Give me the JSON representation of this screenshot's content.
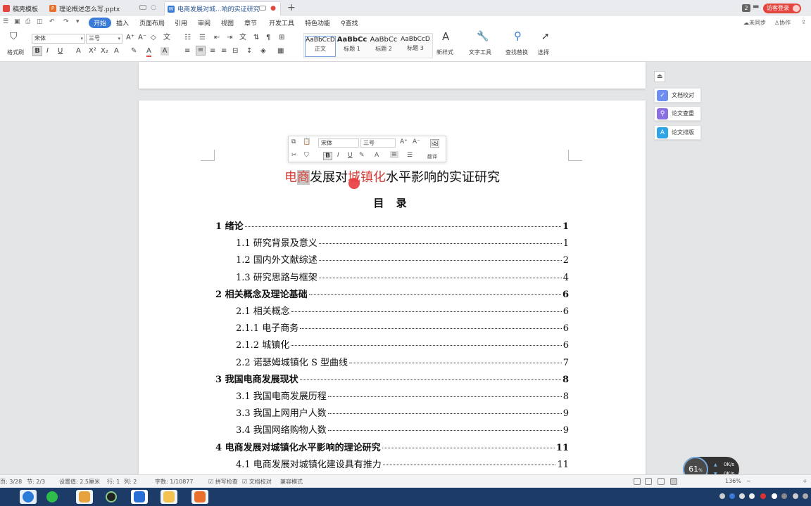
{
  "tabs": [
    {
      "label": "稿壳模板",
      "color": "#e2463f"
    },
    {
      "label": "理论概述怎么写.pptx",
      "color": "#e8702a"
    },
    {
      "label": "电商发展对城...响的实证研究",
      "color": "#3a7bd5"
    }
  ],
  "tab_count": "2",
  "guest_label": "访客登录",
  "menu": {
    "start": "开始",
    "items": [
      "插入",
      "页面布局",
      "引用",
      "审阅",
      "视图",
      "章节",
      "开发工具",
      "特色功能"
    ],
    "search": "查找",
    "right": [
      "未同步",
      "协作",
      "分享"
    ]
  },
  "ribbon": {
    "format_painter": "格式刷",
    "font_name": "宋体",
    "font_size": "三号",
    "styles": [
      {
        "preview": "AaBbCcD",
        "label": "正文"
      },
      {
        "preview": "AaBbCc",
        "label": "标题 1"
      },
      {
        "preview": "AaBbCc",
        "label": "标题 2"
      },
      {
        "preview": "AaBbCcD",
        "label": "标题 3"
      }
    ],
    "new_style": "新样式",
    "text_tools": "文字工具",
    "find_replace": "查找替换",
    "select": "选择"
  },
  "document": {
    "title_parts": [
      "电",
      "商",
      "发展对",
      "城镇化",
      "水平影响的实证研究"
    ],
    "toc_heading": "目 录",
    "toc": [
      {
        "level": 1,
        "text": "1  绪论",
        "page": "1"
      },
      {
        "level": 2,
        "text": "1.1 研究背景及意义",
        "page": "1"
      },
      {
        "level": 2,
        "text": "1.2 国内外文献综述",
        "page": "2"
      },
      {
        "level": 2,
        "text": "1.3  研究思路与框架",
        "page": "4"
      },
      {
        "level": 1,
        "text": "2  相关概念及理论基础",
        "page": "6"
      },
      {
        "level": 2,
        "text": "2.1 相关概念",
        "page": "6"
      },
      {
        "level": 2,
        "text": "2.1.1 电子商务",
        "page": "6"
      },
      {
        "level": 2,
        "text": "2.1.2 城镇化",
        "page": "6"
      },
      {
        "level": 2,
        "text": "2.2 诺瑟姆城镇化 S 型曲线",
        "page": "7"
      },
      {
        "level": 1,
        "text": "3  我国电商发展现状",
        "page": "8"
      },
      {
        "level": 2,
        "text": "3.1 我国电商发展历程",
        "page": "8"
      },
      {
        "level": 2,
        "text": "3.3 我国上网用户人数",
        "page": "9"
      },
      {
        "level": 2,
        "text": "3.4 我国网络购物人数",
        "page": "9"
      },
      {
        "level": 1,
        "text": "4  电商发展对城镇化水平影响的理论研究",
        "page": "11"
      },
      {
        "level": 2,
        "text": "4.1  电商发展对城镇化建设具有推力",
        "page": "11"
      }
    ]
  },
  "minibar": {
    "font_name": "宋体",
    "font_size": "三号",
    "translate": "翻译"
  },
  "right_panel": [
    {
      "label": "文档校对",
      "color": "#6f8ff0"
    },
    {
      "label": "论文查重",
      "color": "#8b6fe0"
    },
    {
      "label": "论文排版",
      "color": "#2fa3e6"
    }
  ],
  "status": {
    "page": "页: 3/28",
    "section": "节: 2/3",
    "setting": "设置值: 2.5厘米",
    "row": "行: 1",
    "col": "列: 2",
    "words": "字数: 1/10877",
    "spell": "拼写检查",
    "proof": "文档校对",
    "compat": "兼容模式",
    "zoom": "136%"
  },
  "net_widget": {
    "percent": "61",
    "up": "0K/s",
    "down": "0K/s"
  }
}
